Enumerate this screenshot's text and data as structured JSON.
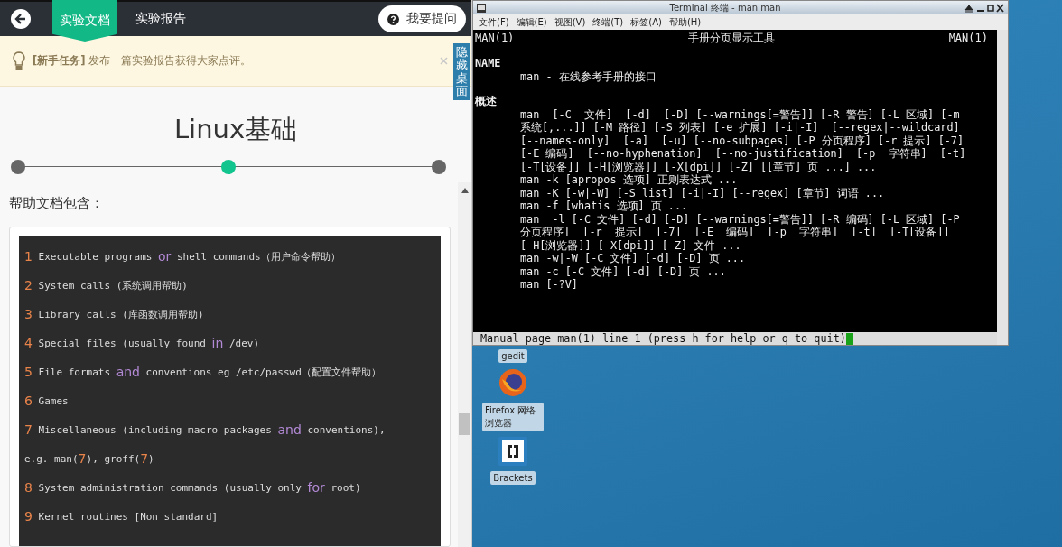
{
  "lab_page": {
    "tabs": [
      {
        "label": "实验文档",
        "selected": true
      },
      {
        "label": "实验报告",
        "selected": false
      }
    ],
    "ask_button": "我要提问",
    "notice": "**[新手任务]** 发布一篇实验报告获得大家点评。",
    "hide_desktop": "隐藏桌面",
    "title": "Linux基础",
    "steps": [
      {
        "selected": false
      },
      {
        "selected": true
      },
      {
        "selected": false
      }
    ],
    "intro": "帮助文档包含：",
    "code_lines": [
      [
        {
          "text": "1",
          "kind": "number"
        },
        {
          "text": " Executable programs ",
          "kind": "plain"
        },
        {
          "text": "or",
          "kind": "keyword"
        },
        {
          "text": " shell commands（用户命令帮助）",
          "kind": "plain"
        }
      ],
      [
        {
          "text": "2",
          "kind": "number"
        },
        {
          "text": " System calls (系统调用帮助)",
          "kind": "plain"
        }
      ],
      [
        {
          "text": "3",
          "kind": "number"
        },
        {
          "text": " Library calls (库函数调用帮助)",
          "kind": "plain"
        }
      ],
      [
        {
          "text": "4",
          "kind": "number"
        },
        {
          "text": " Special files (usually found ",
          "kind": "plain"
        },
        {
          "text": "in",
          "kind": "keyword"
        },
        {
          "text": " /dev)",
          "kind": "plain"
        }
      ],
      [
        {
          "text": "5",
          "kind": "number"
        },
        {
          "text": " File formats ",
          "kind": "plain"
        },
        {
          "text": "and",
          "kind": "keyword"
        },
        {
          "text": " conventions eg /etc/passwd（配置文件帮助）",
          "kind": "plain"
        }
      ],
      [
        {
          "text": "6",
          "kind": "number"
        },
        {
          "text": " Games",
          "kind": "plain"
        }
      ],
      [
        {
          "text": "7",
          "kind": "number"
        },
        {
          "text": " Miscellaneous (including macro packages ",
          "kind": "plain"
        },
        {
          "text": "and",
          "kind": "keyword"
        },
        {
          "text": " conventions),",
          "kind": "plain"
        }
      ],
      [
        {
          "text": "e.g. man(",
          "kind": "plain"
        },
        {
          "text": "7",
          "kind": "number"
        },
        {
          "text": "), groff(",
          "kind": "plain"
        },
        {
          "text": "7",
          "kind": "number"
        },
        {
          "text": ")",
          "kind": "plain"
        }
      ],
      [
        {
          "text": "8",
          "kind": "number"
        },
        {
          "text": " System administration commands (usually only ",
          "kind": "plain"
        },
        {
          "text": "for",
          "kind": "keyword"
        },
        {
          "text": " root)",
          "kind": "plain"
        }
      ],
      [
        {
          "text": "9",
          "kind": "number"
        },
        {
          "text": " Kernel routines [Non standard]",
          "kind": "plain"
        }
      ]
    ]
  },
  "terminal": {
    "title": "Terminal 终端 - man man",
    "menu": [
      "文件(F)",
      "编辑(E)",
      "视图(V)",
      "终端(T)",
      "标签(A)",
      "帮助(H)"
    ],
    "header": {
      "left": "MAN(1)",
      "center": "手册分页显示工具",
      "right": "MAN(1)"
    },
    "lines": [
      {
        "kind": "heading",
        "text": "NAME"
      },
      {
        "kind": "body",
        "text": "man - 在线参考手册的接口"
      },
      {
        "kind": "heading",
        "text": "概述"
      },
      {
        "kind": "body",
        "text": "man  [-C  文件]  [-d]  [-D] [--warnings[=警告]] [-R 警告] [-L 区域] [-m"
      },
      {
        "kind": "body",
        "text": "系统[,...]] [-M 路径] [-S 列表] [-e 扩展] [-i|-I]  [--regex|--wildcard]"
      },
      {
        "kind": "body",
        "text": "[--names-only]  [-a]  [-u] [--no-subpages] [-P 分页程序] [-r 提示] [-7]"
      },
      {
        "kind": "body",
        "text": "[-E 编码]  [--no-hyphenation]  [--no-justification]  [-p  字符串]  [-t]"
      },
      {
        "kind": "body",
        "text": "[-T[设备]] [-H[浏览器]] [-X[dpi]] [-Z] [[章节] 页 ...] ..."
      },
      {
        "kind": "body",
        "text": "man -k [apropos 选项] 正则表达式 ..."
      },
      {
        "kind": "body",
        "text": "man -K [-w|-W] [-S list] [-i|-I] [--regex] [章节] 词语 ..."
      },
      {
        "kind": "body",
        "text": "man -f [whatis 选项] 页 ..."
      },
      {
        "kind": "body",
        "text": "man  -l [-C 文件] [-d] [-D] [--warnings[=警告]] [-R 编码] [-L 区域] [-P"
      },
      {
        "kind": "body",
        "text": "分页程序]  [-r  提示]  [-7]  [-E  编码]  [-p  字符串]  [-t]  [-T[设备]]"
      },
      {
        "kind": "body",
        "text": "[-H[浏览器]] [-X[dpi]] [-Z] 文件 ..."
      },
      {
        "kind": "body",
        "text": "man -w|-W [-C 文件] [-d] [-D] 页 ..."
      },
      {
        "kind": "body",
        "text": "man -c [-C 文件] [-d] [-D] 页 ..."
      },
      {
        "kind": "body",
        "text": "man [-?V]"
      }
    ],
    "status": "Manual page man(1) line 1 (press h for help or q to quit)"
  },
  "desktop_icons": [
    {
      "kind": "label_only",
      "label": "gedit"
    },
    {
      "kind": "firefox",
      "label": "Firefox 网络浏览器"
    },
    {
      "kind": "brackets",
      "label": "Brackets"
    }
  ]
}
